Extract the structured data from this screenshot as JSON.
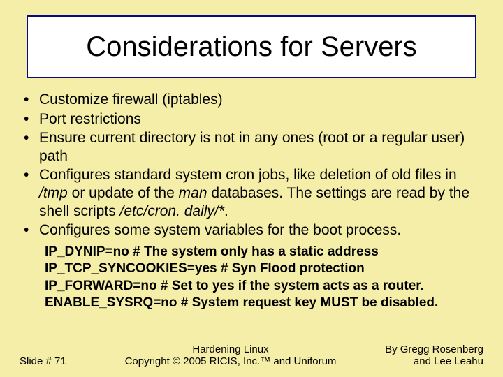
{
  "title": "Considerations for Servers",
  "bullets": {
    "b0": "Customize firewall (iptables)",
    "b1": "Port restrictions",
    "b2": "Ensure current directory is not in any ones (root or a regular user) path",
    "b3_a": "Configures standard system cron jobs, like deletion of old files in ",
    "b3_tmp": "/tmp",
    "b3_b": " or update of the ",
    "b3_man": "man",
    "b3_c": " databases. The settings are read by the shell scripts ",
    "b3_cron": "/etc/cron. daily/*",
    "b3_d": ".",
    "b4": "Configures some system variables for the boot process."
  },
  "sysvars": {
    "l0": "IP_DYNIP=no # The system only has a static address",
    "l1": "IP_TCP_SYNCOOKIES=yes # Syn Flood protection",
    "l2": "IP_FORWARD=no # Set to yes if the system acts as a router.",
    "l3": "ENABLE_SYSRQ=no # System request key MUST be disabled."
  },
  "footer": {
    "left": "Slide # 71",
    "center_line1": "Hardening Linux",
    "center_line2": "Copyright © 2005 RICIS, Inc.™ and Uniforum",
    "right_line1": "By Gregg Rosenberg",
    "right_line2": "and Lee Leahu"
  }
}
